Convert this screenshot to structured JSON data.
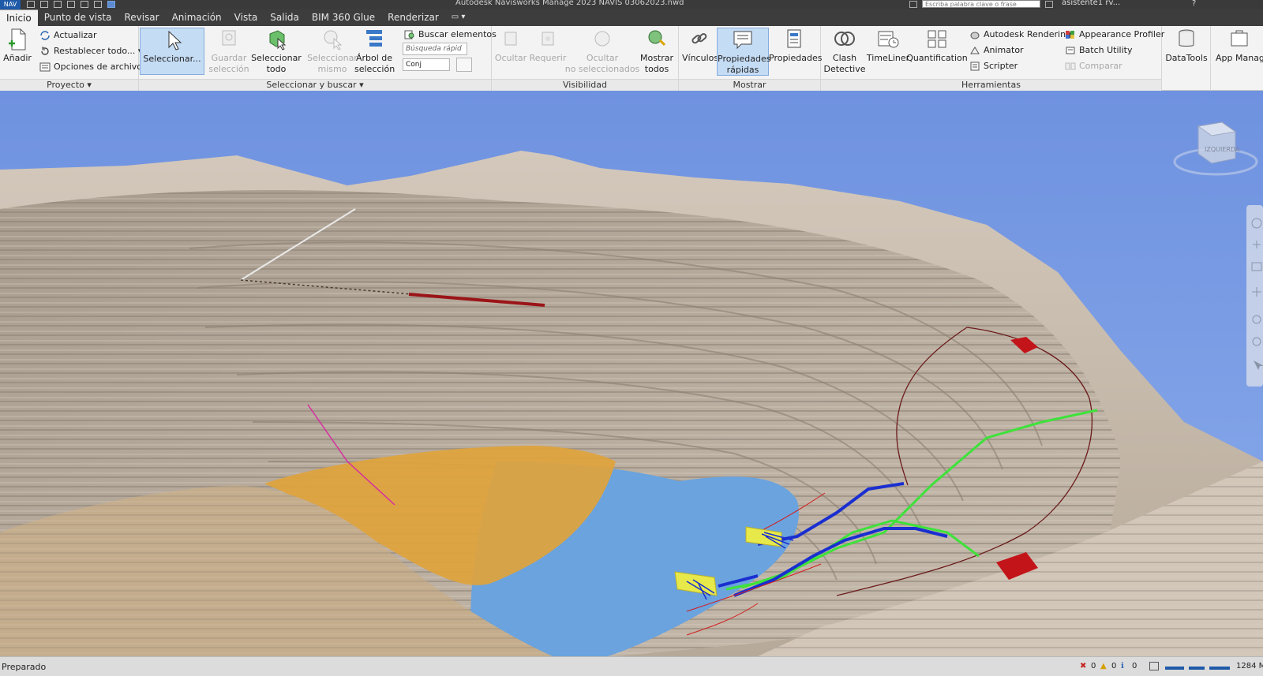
{
  "titlebar": {
    "app_logo": "NAV",
    "title": "Autodesk Navisworks Manage 2023    NAVIS 03062023.nwd",
    "search_placeholder": "Escriba palabra clave o frase",
    "user": "asistente1 rv...",
    "help_label": "?"
  },
  "tabs": [
    "Inicio",
    "Punto de vista",
    "Revisar",
    "Animación",
    "Vista",
    "Salida",
    "BIM 360 Glue",
    "Renderizar",
    "▭ ▾"
  ],
  "active_tab": "Inicio",
  "ribbon": {
    "proyecto": {
      "label": "Proyecto ▾",
      "anadir": "Añadir",
      "actualizar": "Actualizar",
      "restablecer": "Restablecer todo... ▾",
      "opciones": "Opciones de archivo"
    },
    "seleccionar": {
      "label": "Seleccionar y buscar ▾",
      "seleccionar": "Seleccionar...",
      "guardar_1": "Guardar",
      "guardar_2": "selección",
      "seleccionar_todo_1": "Seleccionar",
      "seleccionar_todo_2": "todo",
      "seleccionar_mismo_1": "Seleccionar",
      "seleccionar_mismo_2": "mismo",
      "arbol_1": "Árbol de",
      "arbol_2": "selección",
      "buscar": "Buscar elementos",
      "busqueda_placeholder": "Búsqueda rápid",
      "conjunto": "Conj"
    },
    "visibilidad": {
      "label": "Visibilidad",
      "ocultar": "Ocultar",
      "requerir": "Requerir",
      "ocultar_no_sel_1": "Ocultar",
      "ocultar_no_sel_2": "no seleccionados",
      "mostrar_1": "Mostrar",
      "mostrar_2": "todos"
    },
    "mostrar": {
      "label": "Mostrar",
      "vinculos": "Vínculos",
      "prop_rapidas_1": "Propiedades",
      "prop_rapidas_2": "rápidas",
      "propiedades": "Propiedades"
    },
    "herramientas": {
      "label": "Herramientas",
      "clash_1": "Clash",
      "clash_2": "Detective",
      "timeliner": "TimeLiner",
      "quantification": "Quantification",
      "autodesk_rendering": "Autodesk Rendering",
      "animator": "Animator",
      "scripter": "Scripter",
      "appearance_profiler": "Appearance Profiler",
      "batch_utility": "Batch Utility",
      "comparar": "Comparar"
    },
    "datatools": "DataTools",
    "app_manager": "App Manager"
  },
  "viewcube": {
    "face_label": "IZQUIERDA"
  },
  "status": {
    "text": "Preparado",
    "errors": "0",
    "warnings": "0",
    "info": "0",
    "memory": "1284 M"
  },
  "colors": {
    "sky": "#7d9fe2",
    "terrain": "#c8bcae",
    "water": "#6aa3de",
    "orange_region": "#e0a33c",
    "pipe_blue": "#1a2fd0",
    "pipe_green": "#3ee23a",
    "structure_yellow": "#e7e84a",
    "red_block": "#c3141a"
  }
}
